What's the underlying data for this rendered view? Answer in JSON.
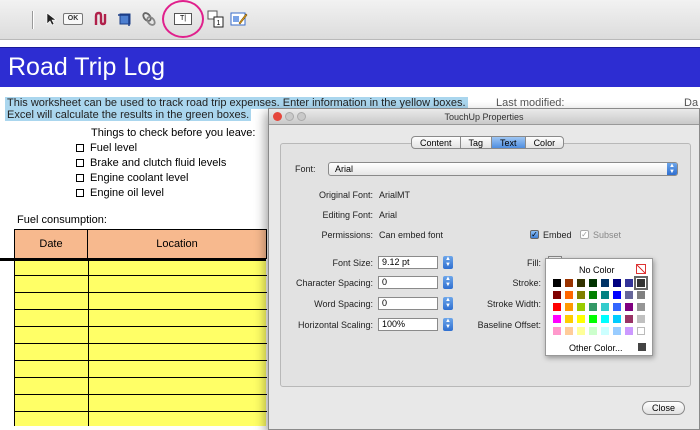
{
  "toolbar": {
    "items": [
      {
        "name": "select-object-icon",
        "glyph": "➤"
      },
      {
        "name": "ok-button",
        "glyph": "OK"
      },
      {
        "name": "path-tool-icon",
        "glyph": "Ʊ"
      },
      {
        "name": "crop-tool-icon",
        "glyph": "⌗"
      },
      {
        "name": "link-tool-icon",
        "glyph": "⛓"
      },
      {
        "name": "touchup-text-icon",
        "glyph": "T"
      },
      {
        "name": "reading-order-icon",
        "glyph": "1"
      },
      {
        "name": "edit-object-icon",
        "glyph": "✎"
      }
    ]
  },
  "document": {
    "title": "Road Trip Log",
    "intro_line1": "This worksheet can be used to track road trip expenses. Enter information in the yellow boxes.",
    "intro_line2": "Excel will calculate the results in the green boxes.",
    "last_modified_label": "Last modified:",
    "da_label": "Da",
    "checklist_title": "Things to check before you leave:",
    "checklist": [
      "Fuel level",
      "Brake and clutch fluid levels",
      "Engine coolant level",
      "Engine oil level"
    ],
    "fuel_label": "Fuel consumption:",
    "table_headers": [
      "Date",
      "Location"
    ]
  },
  "dialog": {
    "title": "TouchUp Properties",
    "tabs": [
      "Content",
      "Tag",
      "Text",
      "Color"
    ],
    "active_tab": "Text",
    "font_label": "Font:",
    "font_value": "Arial",
    "original_font_label": "Original Font:",
    "original_font_value": "ArialMT",
    "editing_font_label": "Editing Font:",
    "editing_font_value": "Arial",
    "permissions_label": "Permissions:",
    "permissions_value": "Can embed font",
    "embed_label": "Embed",
    "subset_label": "Subset",
    "font_size_label": "Font Size:",
    "font_size_value": "9.12 pt",
    "char_spacing_label": "Character Spacing:",
    "char_spacing_value": "0",
    "word_spacing_label": "Word Spacing:",
    "word_spacing_value": "0",
    "horiz_scaling_label": "Horizontal Scaling:",
    "horiz_scaling_value": "100%",
    "fill_label": "Fill:",
    "stroke_label": "Stroke:",
    "stroke_width_label": "Stroke Width:",
    "baseline_offset_label": "Baseline Offset:",
    "close_label": "Close"
  },
  "color_picker": {
    "no_color_label": "No Color",
    "other_color_label": "Other Color...",
    "rows": [
      [
        "#000000",
        "#993300",
        "#333300",
        "#003300",
        "#003366",
        "#000080",
        "#333399",
        "#333333"
      ],
      [
        "#800000",
        "#ff6600",
        "#808000",
        "#008000",
        "#008080",
        "#0000ff",
        "#666699",
        "#808080"
      ],
      [
        "#ff0000",
        "#ff9900",
        "#99cc00",
        "#339966",
        "#33cccc",
        "#3366ff",
        "#800080",
        "#969696"
      ],
      [
        "#ff00ff",
        "#ffcc00",
        "#ffff00",
        "#00ff00",
        "#00ffff",
        "#00ccff",
        "#993366",
        "#c0c0c0"
      ],
      [
        "#ff99cc",
        "#ffcc99",
        "#ffff99",
        "#ccffcc",
        "#ccffff",
        "#99ccff",
        "#cc99ff",
        "#ffffff"
      ]
    ],
    "selected": "#333333"
  }
}
